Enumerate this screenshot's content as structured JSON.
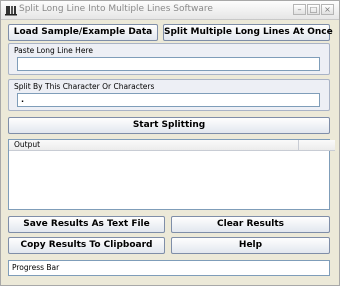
{
  "window": {
    "title": "Split Long Line Into Multiple Lines Software",
    "minimize_glyph": "–",
    "maximize_glyph": "□",
    "close_glyph": "×"
  },
  "toolbar": {
    "load_sample_label": "Load Sample/Example Data",
    "split_multiple_label": "Split Multiple Long Lines At Once"
  },
  "paste_group": {
    "label": "Paste Long Line Here",
    "value": ""
  },
  "split_char_group": {
    "label": "Split By This Character Or Characters",
    "value": "."
  },
  "start_button_label": "Start Splitting",
  "output": {
    "column_header": "Output",
    "rows": []
  },
  "actions": {
    "save_label": "Save Results As Text File",
    "clear_label": "Clear Results",
    "copy_label": "Copy Results To Clipboard",
    "help_label": "Help"
  },
  "status": {
    "progress_label": "Progress Bar"
  },
  "icons": {
    "app": "app-logo-icon"
  }
}
